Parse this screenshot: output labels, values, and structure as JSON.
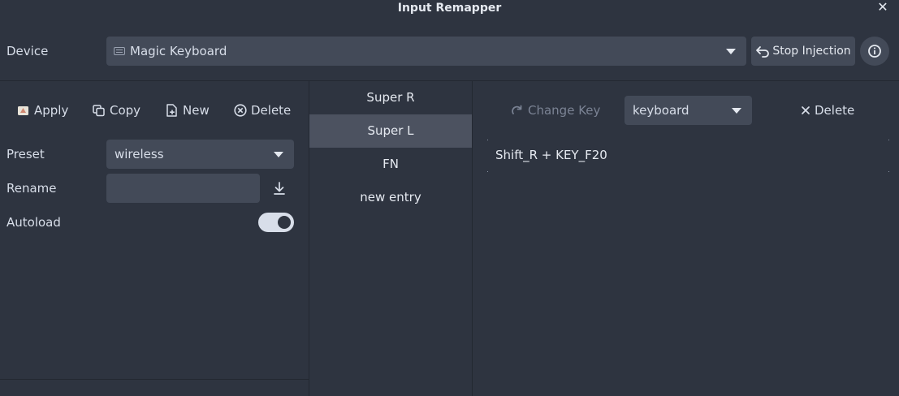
{
  "window": {
    "title": "Input Remapper"
  },
  "device": {
    "label": "Device",
    "selected": "Magic Keyboard",
    "stop_injection_label": "Stop Injection"
  },
  "preset_toolbar": {
    "apply": "Apply",
    "copy": "Copy",
    "new": "New",
    "delete": "Delete"
  },
  "preset": {
    "label": "Preset",
    "selected": "wireless",
    "rename_label": "Rename",
    "rename_value": "",
    "autoload_label": "Autoload",
    "autoload_on": true
  },
  "mappings": [
    {
      "label": "Super R",
      "selected": false
    },
    {
      "label": "Super L",
      "selected": true
    },
    {
      "label": "FN",
      "selected": false
    },
    {
      "label": "new entry",
      "selected": false
    }
  ],
  "editor": {
    "change_key": "Change Key",
    "target": "keyboard",
    "delete": "Delete",
    "mapping_text": "Shift_R + KEY_F20"
  },
  "colors": {
    "background": "#2e3440",
    "widget": "#434a58",
    "selected_row": "#4c5260",
    "text": "#d8dee9",
    "disabled_text": "#7b8394"
  }
}
